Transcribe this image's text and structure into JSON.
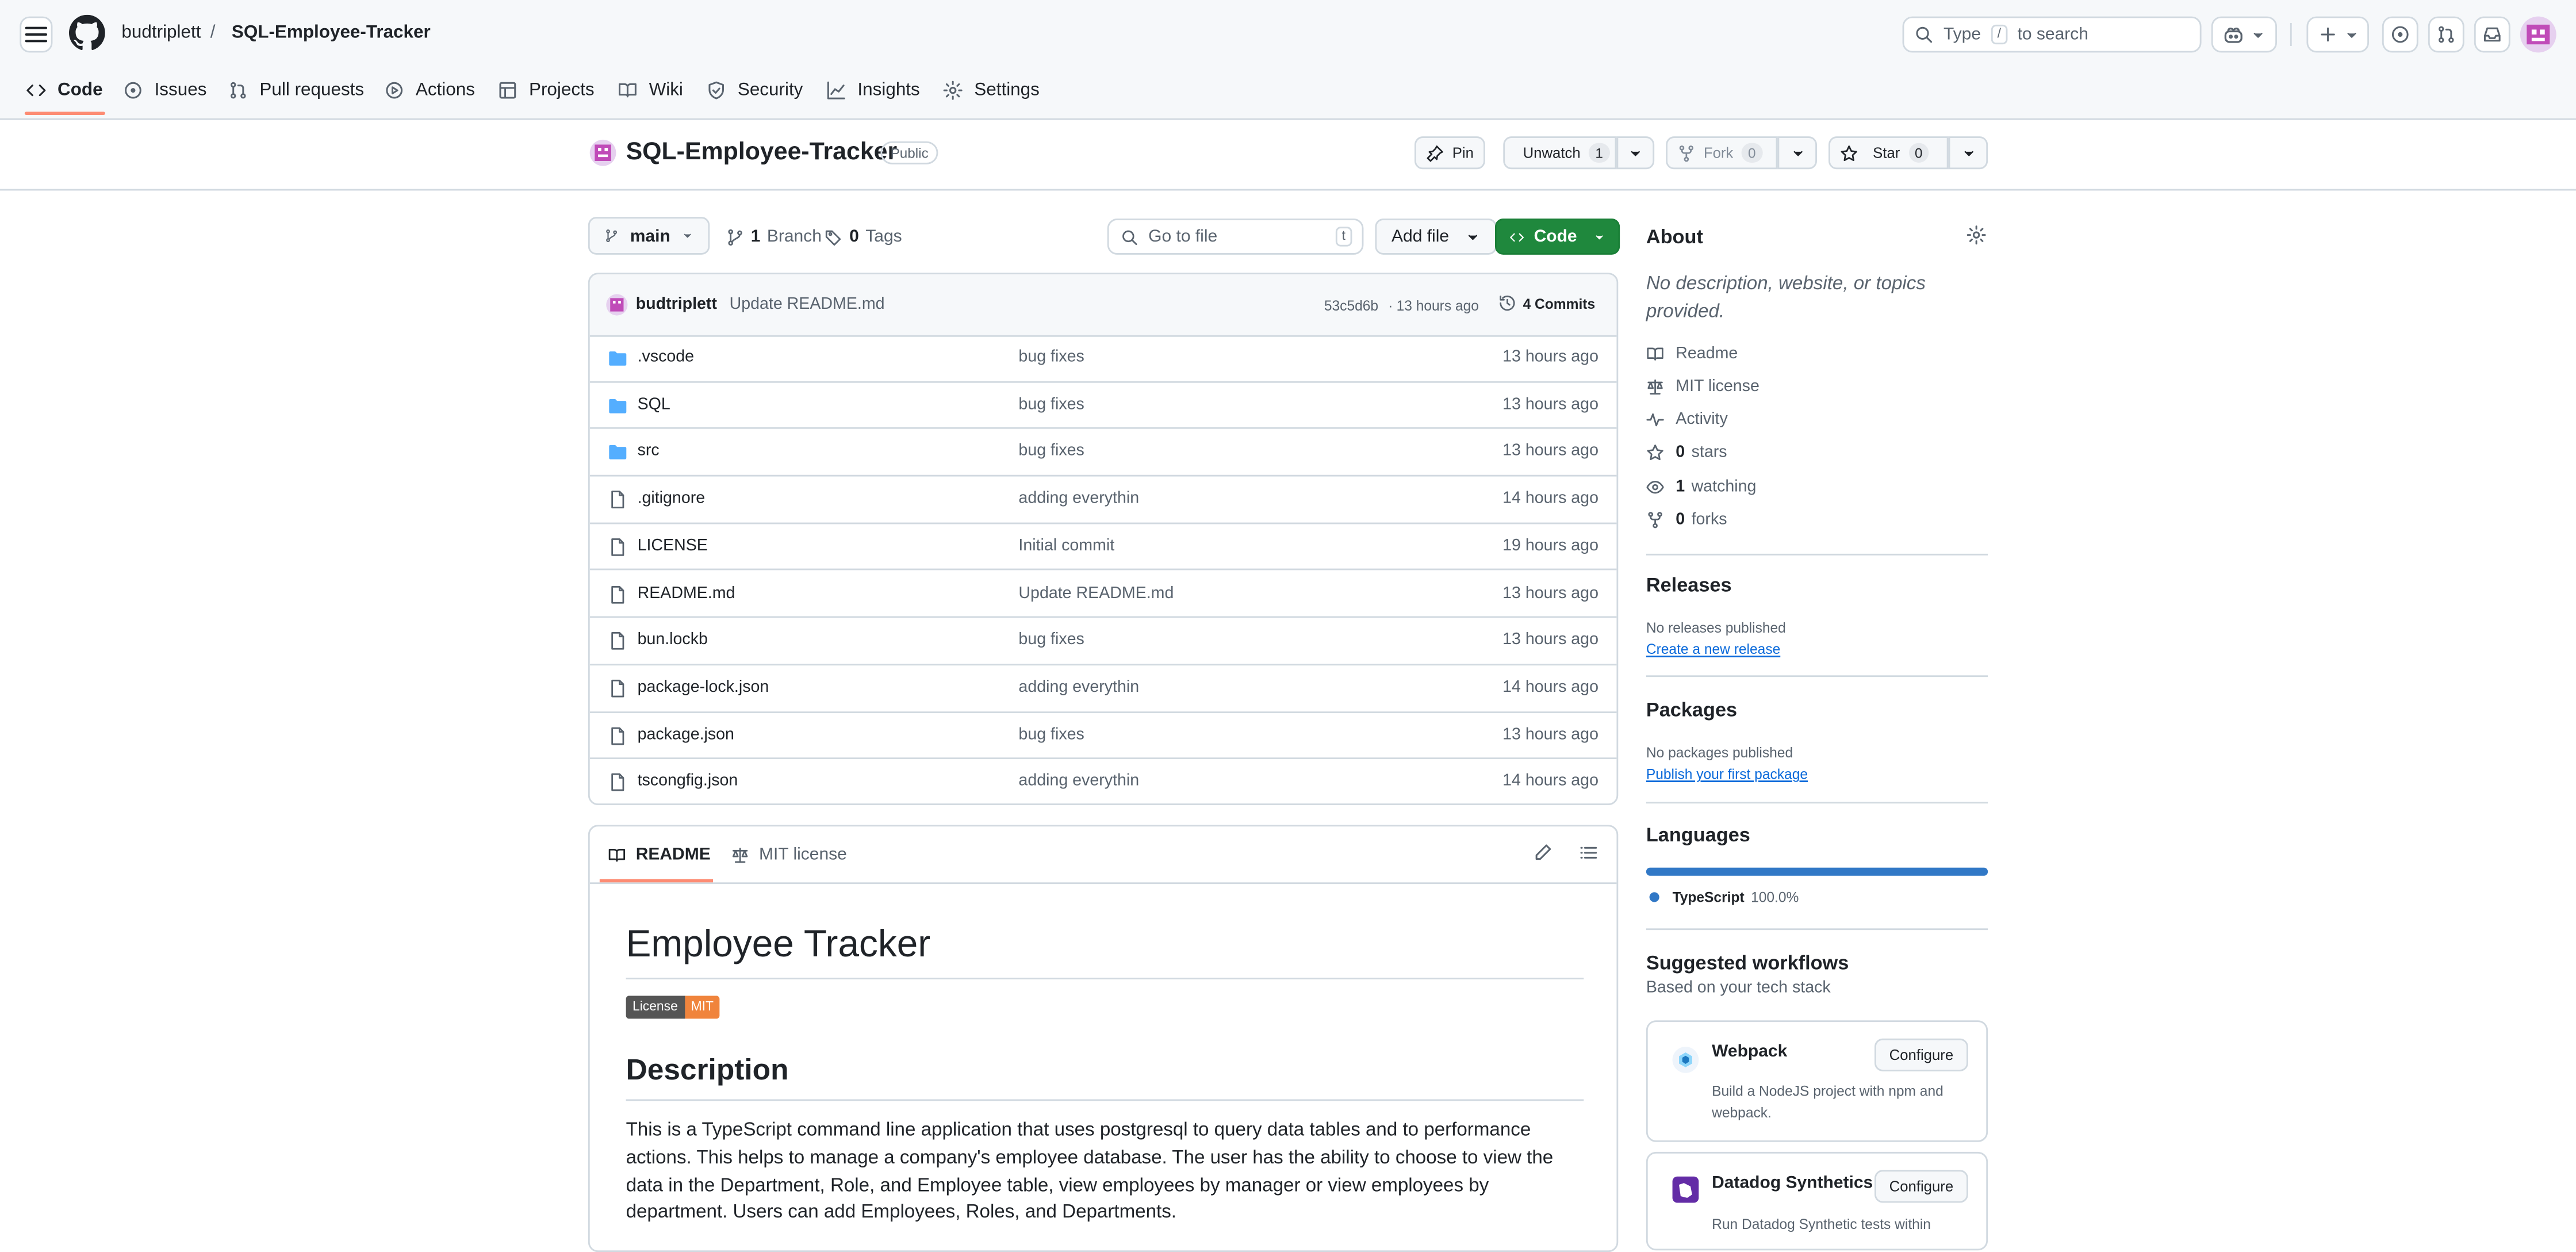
{
  "header": {
    "owner": "budtriplett",
    "separator": "/",
    "repo": "SQL-Employee-Tracker",
    "search": {
      "prefix": "Type",
      "key": "/",
      "suffix": "to search"
    }
  },
  "nav_tabs": [
    {
      "label": "Code",
      "icon": "code-icon",
      "active": true
    },
    {
      "label": "Issues",
      "icon": "issue-icon"
    },
    {
      "label": "Pull requests",
      "icon": "pull-request-icon"
    },
    {
      "label": "Actions",
      "icon": "play-icon"
    },
    {
      "label": "Projects",
      "icon": "table-icon"
    },
    {
      "label": "Wiki",
      "icon": "book-icon"
    },
    {
      "label": "Security",
      "icon": "shield-icon"
    },
    {
      "label": "Insights",
      "icon": "graph-icon"
    },
    {
      "label": "Settings",
      "icon": "gear-icon"
    }
  ],
  "repo_head": {
    "title": "SQL-Employee-Tracker",
    "visibility": "Public",
    "pin": "Pin",
    "unwatch": "Unwatch",
    "watch_count": "1",
    "fork": "Fork",
    "fork_count": "0",
    "star": "Star",
    "star_count": "0"
  },
  "toolbar": {
    "branch": "main",
    "branches_count": "1",
    "branches_label": "Branch",
    "tags_count": "0",
    "tags_label": "Tags",
    "goto_placeholder": "Go to file",
    "goto_key": "t",
    "add_file": "Add file",
    "code": "Code"
  },
  "commit": {
    "author": "budtriplett",
    "message": "Update README.md",
    "hash": "53c5d6b",
    "dot": "·",
    "time": "13 hours ago",
    "commits": "4 Commits"
  },
  "files": [
    {
      "name": ".vscode",
      "type": "folder",
      "message": "bug fixes",
      "age": "13 hours ago"
    },
    {
      "name": "SQL",
      "type": "folder",
      "message": "bug fixes",
      "age": "13 hours ago"
    },
    {
      "name": "src",
      "type": "folder",
      "message": "bug fixes",
      "age": "13 hours ago"
    },
    {
      "name": ".gitignore",
      "type": "file",
      "message": "adding everythin",
      "age": "14 hours ago"
    },
    {
      "name": "LICENSE",
      "type": "file",
      "message": "Initial commit",
      "age": "19 hours ago"
    },
    {
      "name": "README.md",
      "type": "file",
      "message": "Update README.md",
      "age": "13 hours ago"
    },
    {
      "name": "bun.lockb",
      "type": "file",
      "message": "bug fixes",
      "age": "13 hours ago"
    },
    {
      "name": "package-lock.json",
      "type": "file",
      "message": "adding everythin",
      "age": "14 hours ago"
    },
    {
      "name": "package.json",
      "type": "file",
      "message": "bug fixes",
      "age": "13 hours ago"
    },
    {
      "name": "tscongfig.json",
      "type": "file",
      "message": "adding everythin",
      "age": "14 hours ago"
    }
  ],
  "readme": {
    "tab_readme": "README",
    "tab_license": "MIT license",
    "h1": "Employee Tracker",
    "badge_left": "License",
    "badge_right": "MIT",
    "h2": "Description",
    "paragraph": "This is a TypeScript command line application that uses postgresql to query data tables and to performance actions. This helps to manage a company's employee database. The user has the ability to choose to view the data in the Department, Role, and Employee table, view employees by manager or view employees by department. Users can add Employees, Roles, and Departments."
  },
  "about": {
    "title": "About",
    "description": "No description, website, or topics provided.",
    "links": [
      {
        "icon": "book-icon",
        "bold": "",
        "text": "Readme"
      },
      {
        "icon": "scale-icon",
        "bold": "",
        "text": "MIT license"
      },
      {
        "icon": "pulse-icon",
        "bold": "",
        "text": "Activity"
      },
      {
        "icon": "star-icon",
        "bold": "0",
        "text": "stars"
      },
      {
        "icon": "eye-icon",
        "bold": "1",
        "text": "watching"
      },
      {
        "icon": "fork-icon",
        "bold": "0",
        "text": "forks"
      }
    ]
  },
  "releases": {
    "title": "Releases",
    "none": "No releases published",
    "link": "Create a new release"
  },
  "packages": {
    "title": "Packages",
    "none": "No packages published",
    "link": "Publish your first package"
  },
  "languages": {
    "title": "Languages",
    "name": "TypeScript",
    "percent": "100.0%",
    "share": 1.0,
    "color": "#3178c6"
  },
  "workflows": {
    "title": "Suggested workflows",
    "subtitle": "Based on your tech stack",
    "items": [
      {
        "name": "Webpack",
        "button": "Configure",
        "desc": "Build a NodeJS project with npm and webpack."
      },
      {
        "name": "Datadog Synthetics",
        "button": "Configure",
        "desc": "Run Datadog Synthetic tests within"
      }
    ]
  },
  "colors": {
    "accent_underline": "#fd8c73",
    "primary_button": "#1f883d",
    "link": "#0969da"
  }
}
